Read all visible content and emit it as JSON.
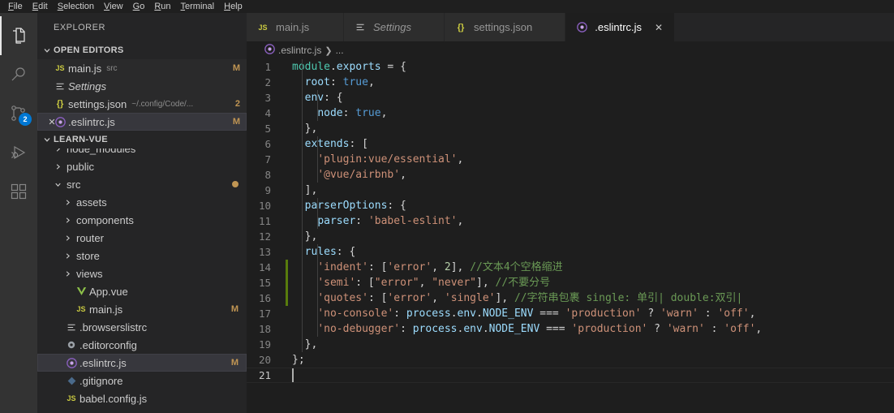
{
  "menubar": {
    "items": [
      {
        "label": "File",
        "mnemonic": "F"
      },
      {
        "label": "Edit",
        "mnemonic": "E"
      },
      {
        "label": "Selection",
        "mnemonic": "S"
      },
      {
        "label": "View",
        "mnemonic": "V"
      },
      {
        "label": "Go",
        "mnemonic": "G"
      },
      {
        "label": "Run",
        "mnemonic": "R"
      },
      {
        "label": "Terminal",
        "mnemonic": "T"
      },
      {
        "label": "Help",
        "mnemonic": "H"
      }
    ]
  },
  "activitybar": {
    "items": [
      {
        "name": "explorer",
        "icon": "files-icon",
        "active": true,
        "badge": ""
      },
      {
        "name": "search",
        "icon": "search-icon",
        "active": false,
        "badge": ""
      },
      {
        "name": "source-control",
        "icon": "source-control-icon",
        "active": false,
        "badge": "2"
      },
      {
        "name": "run-debug",
        "icon": "run-debug-icon",
        "active": false,
        "badge": ""
      },
      {
        "name": "extensions",
        "icon": "extensions-icon",
        "active": false,
        "badge": ""
      }
    ]
  },
  "sidebar": {
    "title": "EXPLORER",
    "open_editors": {
      "header": "OPEN EDITORS",
      "items": [
        {
          "name": "main.js",
          "icon": "js-icon",
          "desc": "src",
          "badge": "M",
          "italic": false,
          "close": false,
          "selected": false
        },
        {
          "name": "Settings",
          "icon": "settings-list-icon",
          "desc": "",
          "badge": "",
          "italic": true,
          "close": false,
          "selected": false
        },
        {
          "name": "settings.json",
          "icon": "json-icon",
          "desc": "~/.config/Code/...",
          "badge": "2",
          "italic": false,
          "close": false,
          "selected": false
        },
        {
          "name": ".eslintrc.js",
          "icon": "eslint-icon",
          "desc": "",
          "badge": "M",
          "italic": false,
          "close": true,
          "selected": true
        }
      ]
    },
    "project": {
      "header": "LEARN-VUE",
      "items": [
        {
          "name": "node_modules",
          "type": "folder",
          "expanded": false,
          "depth": 1,
          "badge": "",
          "icon": "",
          "selected": false,
          "hidden_behind_header": true
        },
        {
          "name": "public",
          "type": "folder",
          "expanded": false,
          "depth": 1,
          "badge": "",
          "icon": "",
          "selected": false
        },
        {
          "name": "src",
          "type": "folder",
          "expanded": true,
          "depth": 1,
          "badge": "dot",
          "icon": "",
          "selected": false
        },
        {
          "name": "assets",
          "type": "folder",
          "expanded": false,
          "depth": 2,
          "badge": "",
          "icon": "",
          "selected": false
        },
        {
          "name": "components",
          "type": "folder",
          "expanded": false,
          "depth": 2,
          "badge": "",
          "icon": "",
          "selected": false
        },
        {
          "name": "router",
          "type": "folder",
          "expanded": false,
          "depth": 2,
          "badge": "",
          "icon": "",
          "selected": false
        },
        {
          "name": "store",
          "type": "folder",
          "expanded": false,
          "depth": 2,
          "badge": "",
          "icon": "",
          "selected": false
        },
        {
          "name": "views",
          "type": "folder",
          "expanded": false,
          "depth": 2,
          "badge": "",
          "icon": "",
          "selected": false
        },
        {
          "name": "App.vue",
          "type": "file",
          "expanded": false,
          "depth": 2,
          "badge": "",
          "icon": "vue-icon",
          "selected": false
        },
        {
          "name": "main.js",
          "type": "file",
          "expanded": false,
          "depth": 2,
          "badge": "M",
          "icon": "js-icon",
          "selected": false
        },
        {
          "name": ".browserslistrc",
          "type": "file",
          "expanded": false,
          "depth": 1,
          "badge": "",
          "icon": "list-icon",
          "selected": false
        },
        {
          "name": ".editorconfig",
          "type": "file",
          "expanded": false,
          "depth": 1,
          "badge": "",
          "icon": "gear-icon",
          "selected": false
        },
        {
          "name": ".eslintrc.js",
          "type": "file",
          "expanded": false,
          "depth": 1,
          "badge": "M",
          "icon": "eslint-icon",
          "selected": true
        },
        {
          "name": ".gitignore",
          "type": "file",
          "expanded": false,
          "depth": 1,
          "badge": "",
          "icon": "git-icon",
          "selected": false
        },
        {
          "name": "babel.config.js",
          "type": "file",
          "expanded": false,
          "depth": 1,
          "badge": "",
          "icon": "js-icon",
          "selected": false
        }
      ]
    }
  },
  "tabs": [
    {
      "label": "main.js",
      "icon": "js-icon",
      "active": false,
      "italic": false,
      "close": false
    },
    {
      "label": "Settings",
      "icon": "settings-list-icon",
      "active": false,
      "italic": true,
      "close": false
    },
    {
      "label": "settings.json",
      "icon": "json-icon",
      "active": false,
      "italic": false,
      "close": false
    },
    {
      "label": ".eslintrc.js",
      "icon": "eslint-icon",
      "active": true,
      "italic": false,
      "close": true
    }
  ],
  "breadcrumb": {
    "file": ".eslintrc.js",
    "separator": "❯",
    "more": "..."
  },
  "editor": {
    "language": "javascript",
    "cursor_line": 21,
    "lines": [
      {
        "n": 1,
        "gutter": "",
        "tokens": [
          {
            "t": "module",
            "c": "green"
          },
          {
            "t": ".",
            "c": "plain"
          },
          {
            "t": "exports",
            "c": "prop"
          },
          {
            "t": " = {",
            "c": "plain"
          }
        ]
      },
      {
        "n": 2,
        "gutter": "",
        "tokens": [
          {
            "t": "  ",
            "c": "plain"
          },
          {
            "t": "root",
            "c": "prop"
          },
          {
            "t": ": ",
            "c": "plain"
          },
          {
            "t": "true",
            "c": "kw"
          },
          {
            "t": ",",
            "c": "plain"
          }
        ]
      },
      {
        "n": 3,
        "gutter": "",
        "tokens": [
          {
            "t": "  ",
            "c": "plain"
          },
          {
            "t": "env",
            "c": "prop"
          },
          {
            "t": ": {",
            "c": "plain"
          }
        ]
      },
      {
        "n": 4,
        "gutter": "",
        "tokens": [
          {
            "t": "    ",
            "c": "plain"
          },
          {
            "t": "node",
            "c": "prop"
          },
          {
            "t": ": ",
            "c": "plain"
          },
          {
            "t": "true",
            "c": "kw"
          },
          {
            "t": ",",
            "c": "plain"
          }
        ]
      },
      {
        "n": 5,
        "gutter": "",
        "tokens": [
          {
            "t": "  },",
            "c": "plain"
          }
        ]
      },
      {
        "n": 6,
        "gutter": "",
        "tokens": [
          {
            "t": "  ",
            "c": "plain"
          },
          {
            "t": "extends",
            "c": "prop"
          },
          {
            "t": ": [",
            "c": "plain"
          }
        ]
      },
      {
        "n": 7,
        "gutter": "",
        "tokens": [
          {
            "t": "    ",
            "c": "plain"
          },
          {
            "t": "'plugin:vue/essential'",
            "c": "str"
          },
          {
            "t": ",",
            "c": "plain"
          }
        ]
      },
      {
        "n": 8,
        "gutter": "",
        "tokens": [
          {
            "t": "    ",
            "c": "plain"
          },
          {
            "t": "'@vue/airbnb'",
            "c": "str"
          },
          {
            "t": ",",
            "c": "plain"
          }
        ]
      },
      {
        "n": 9,
        "gutter": "",
        "tokens": [
          {
            "t": "  ],",
            "c": "plain"
          }
        ]
      },
      {
        "n": 10,
        "gutter": "",
        "tokens": [
          {
            "t": "  ",
            "c": "plain"
          },
          {
            "t": "parserOptions",
            "c": "prop"
          },
          {
            "t": ": {",
            "c": "plain"
          }
        ]
      },
      {
        "n": 11,
        "gutter": "",
        "tokens": [
          {
            "t": "    ",
            "c": "plain"
          },
          {
            "t": "parser",
            "c": "prop"
          },
          {
            "t": ": ",
            "c": "plain"
          },
          {
            "t": "'babel-eslint'",
            "c": "str"
          },
          {
            "t": ",",
            "c": "plain"
          }
        ]
      },
      {
        "n": 12,
        "gutter": "",
        "tokens": [
          {
            "t": "  },",
            "c": "plain"
          }
        ]
      },
      {
        "n": 13,
        "gutter": "",
        "tokens": [
          {
            "t": "  ",
            "c": "plain"
          },
          {
            "t": "rules",
            "c": "prop"
          },
          {
            "t": ": {",
            "c": "plain"
          }
        ]
      },
      {
        "n": 14,
        "gutter": "added",
        "tokens": [
          {
            "t": "    ",
            "c": "plain"
          },
          {
            "t": "'indent'",
            "c": "str"
          },
          {
            "t": ": [",
            "c": "plain"
          },
          {
            "t": "'error'",
            "c": "str"
          },
          {
            "t": ", ",
            "c": "plain"
          },
          {
            "t": "2",
            "c": "num"
          },
          {
            "t": "], ",
            "c": "plain"
          },
          {
            "t": "//文本4个空格缩进",
            "c": "com"
          }
        ]
      },
      {
        "n": 15,
        "gutter": "added",
        "tokens": [
          {
            "t": "    ",
            "c": "plain"
          },
          {
            "t": "'semi'",
            "c": "str"
          },
          {
            "t": ": [",
            "c": "plain"
          },
          {
            "t": "\"error\"",
            "c": "str"
          },
          {
            "t": ", ",
            "c": "plain"
          },
          {
            "t": "\"never\"",
            "c": "str"
          },
          {
            "t": "], ",
            "c": "plain"
          },
          {
            "t": "//不要分号",
            "c": "com"
          }
        ]
      },
      {
        "n": 16,
        "gutter": "added",
        "tokens": [
          {
            "t": "    ",
            "c": "plain"
          },
          {
            "t": "'quotes'",
            "c": "str"
          },
          {
            "t": ": [",
            "c": "plain"
          },
          {
            "t": "'error'",
            "c": "str"
          },
          {
            "t": ", ",
            "c": "plain"
          },
          {
            "t": "'single'",
            "c": "str"
          },
          {
            "t": "], ",
            "c": "plain"
          },
          {
            "t": "//字符串包裹 single: 单引| double:双引|",
            "c": "com"
          }
        ]
      },
      {
        "n": 17,
        "gutter": "",
        "tokens": [
          {
            "t": "    ",
            "c": "plain"
          },
          {
            "t": "'no-console'",
            "c": "str"
          },
          {
            "t": ": ",
            "c": "plain"
          },
          {
            "t": "process",
            "c": "prop"
          },
          {
            "t": ".",
            "c": "plain"
          },
          {
            "t": "env",
            "c": "prop"
          },
          {
            "t": ".",
            "c": "plain"
          },
          {
            "t": "NODE_ENV",
            "c": "prop"
          },
          {
            "t": " === ",
            "c": "plain"
          },
          {
            "t": "'production'",
            "c": "str"
          },
          {
            "t": " ? ",
            "c": "plain"
          },
          {
            "t": "'warn'",
            "c": "str"
          },
          {
            "t": " : ",
            "c": "plain"
          },
          {
            "t": "'off'",
            "c": "str"
          },
          {
            "t": ",",
            "c": "plain"
          }
        ]
      },
      {
        "n": 18,
        "gutter": "",
        "tokens": [
          {
            "t": "    ",
            "c": "plain"
          },
          {
            "t": "'no-debugger'",
            "c": "str"
          },
          {
            "t": ": ",
            "c": "plain"
          },
          {
            "t": "process",
            "c": "prop"
          },
          {
            "t": ".",
            "c": "plain"
          },
          {
            "t": "env",
            "c": "prop"
          },
          {
            "t": ".",
            "c": "plain"
          },
          {
            "t": "NODE_ENV",
            "c": "prop"
          },
          {
            "t": " === ",
            "c": "plain"
          },
          {
            "t": "'production'",
            "c": "str"
          },
          {
            "t": " ? ",
            "c": "plain"
          },
          {
            "t": "'warn'",
            "c": "str"
          },
          {
            "t": " : ",
            "c": "plain"
          },
          {
            "t": "'off'",
            "c": "str"
          },
          {
            "t": ",",
            "c": "plain"
          }
        ]
      },
      {
        "n": 19,
        "gutter": "",
        "tokens": [
          {
            "t": "  },",
            "c": "plain"
          }
        ]
      },
      {
        "n": 20,
        "gutter": "",
        "tokens": [
          {
            "t": "};",
            "c": "plain"
          }
        ]
      },
      {
        "n": 21,
        "gutter": "",
        "tokens": []
      }
    ]
  },
  "colors": {
    "editor_bg": "#1e1e1e",
    "sidebar_bg": "#252526",
    "activitybar_bg": "#333333",
    "accent_badge": "#0078d4",
    "modified": "#c09553",
    "added_gutter": "#587c0c"
  }
}
